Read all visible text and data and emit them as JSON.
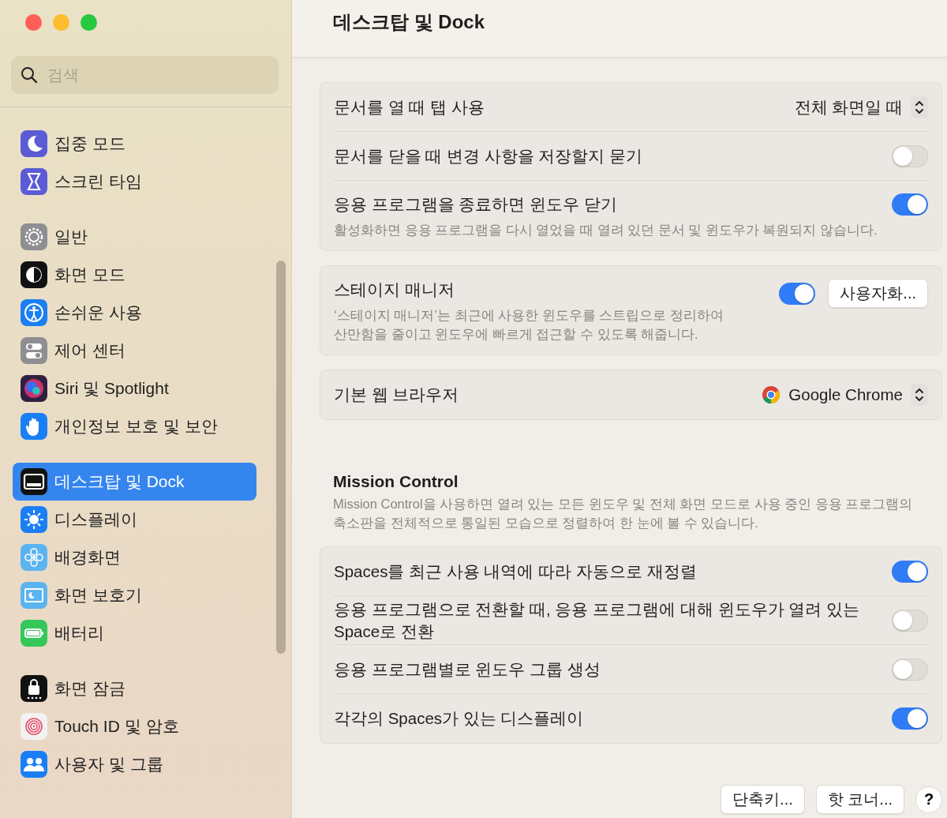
{
  "window": {
    "title": "데스크탑 및 Dock"
  },
  "sidebar": {
    "search": {
      "placeholder": "검색"
    },
    "groups": [
      {
        "items": [
          {
            "label": "집중 모드",
            "selected": false
          },
          {
            "label": "스크린 타임",
            "selected": false
          }
        ]
      },
      {
        "items": [
          {
            "label": "일반",
            "selected": false
          },
          {
            "label": "화면 모드",
            "selected": false
          },
          {
            "label": "손쉬운 사용",
            "selected": false
          },
          {
            "label": "제어 센터",
            "selected": false
          },
          {
            "label": "Siri 및 Spotlight",
            "selected": false
          },
          {
            "label": "개인정보 보호 및 보안",
            "selected": false
          }
        ]
      },
      {
        "items": [
          {
            "label": "데스크탑 및 Dock",
            "selected": true
          },
          {
            "label": "디스플레이",
            "selected": false
          },
          {
            "label": "배경화면",
            "selected": false
          },
          {
            "label": "화면 보호기",
            "selected": false
          },
          {
            "label": "배터리",
            "selected": false
          }
        ]
      },
      {
        "items": [
          {
            "label": "화면 잠금",
            "selected": false
          },
          {
            "label": "Touch ID 및 암호",
            "selected": false
          },
          {
            "label": "사용자 및 그룹",
            "selected": false
          }
        ]
      }
    ]
  },
  "cards": [
    {
      "rows": [
        {
          "kind": "popup",
          "label": "문서를 열 때 탭 사용",
          "value": "전체 화면일 때"
        },
        {
          "kind": "toggle",
          "label": "문서를 닫을 때 변경 사항을 저장할지 묻기",
          "on": false
        },
        {
          "kind": "toggle",
          "label": "응용 프로그램을 종료하면 윈도우 닫기",
          "description": "활성화하면 응용 프로그램을 다시 열었을 때 열려 있던 문서 및 윈도우가 복원되지 않습니다.",
          "on": true
        }
      ]
    },
    {
      "rows": [
        {
          "kind": "toggle",
          "label": "스테이지 매니저",
          "description": "‘스테이지 매니저’는 최근에 사용한 윈도우를 스트립으로 정리하여\n산만함을 줄이고 윈도우에 빠르게 접근할 수 있도록 해줍니다.",
          "on": true,
          "button": "사용자화..."
        }
      ]
    },
    {
      "rows": [
        {
          "kind": "app_popup",
          "label": "기본 웹 브라우저",
          "value": "Google Chrome"
        }
      ]
    }
  ],
  "mission_control": {
    "heading": "Mission Control",
    "description": "Mission Control을 사용하면 열려 있는 모든 윈도우 및 전체 화면 모드로 사용 중인 응용 프로그램의\n축소판을 전체적으로 통일된 모습으로 정렬하여 한 눈에 볼 수 있습니다.",
    "rows": [
      {
        "kind": "toggle",
        "label": "Spaces를 최근 사용 내역에 따라 자동으로 재정렬",
        "on": true
      },
      {
        "kind": "toggle",
        "label": "응용 프로그램으로 전환할 때, 응용 프로그램에 대해 윈도우가 열려 있는\nSpace로 전환",
        "on": false
      },
      {
        "kind": "toggle",
        "label": "응용 프로그램별로 윈도우 그룹 생성",
        "on": false
      },
      {
        "kind": "toggle",
        "label": "각각의 Spaces가 있는 디스플레이",
        "on": true
      }
    ]
  },
  "footer_buttons": [
    "단축키...",
    "핫 코너..."
  ],
  "help": "?"
}
